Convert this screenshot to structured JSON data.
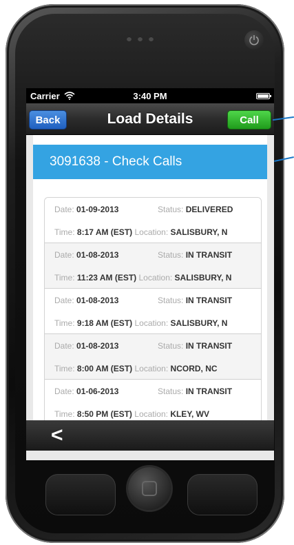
{
  "status_bar": {
    "carrier": "Carrier",
    "time": "3:40 PM"
  },
  "nav": {
    "back_label": "Back",
    "title": "Load Details",
    "call_label": "Call"
  },
  "section": {
    "title": "3091638 - Check Calls"
  },
  "labels": {
    "date": "Date:",
    "status": "Status:",
    "time": "Time:",
    "location": "Location:"
  },
  "entries": [
    {
      "date": "01-09-2013",
      "status": "DELIVERED",
      "time": "8:17 AM (EST)",
      "location": "SALISBURY, N"
    },
    {
      "date": "01-08-2013",
      "status": "IN TRANSIT",
      "time": "11:23 AM (EST)",
      "location": "SALISBURY, N"
    },
    {
      "date": "01-08-2013",
      "status": "IN TRANSIT",
      "time": "9:18 AM (EST)",
      "location": "SALISBURY, N"
    },
    {
      "date": "01-08-2013",
      "status": "IN TRANSIT",
      "time": "8:00 AM (EST)",
      "location": "NCORD, NC"
    },
    {
      "date": "01-06-2013",
      "status": "IN TRANSIT",
      "time": "8:50 PM (EST)",
      "location": "KLEY, WV"
    }
  ],
  "tab_bar": {
    "back_icon": "chevron-left-icon",
    "back_glyph": "<"
  },
  "colors": {
    "header_blue": "#34a3e2",
    "back_blue": "#1f5fc0",
    "call_green": "#1f9b1b"
  }
}
